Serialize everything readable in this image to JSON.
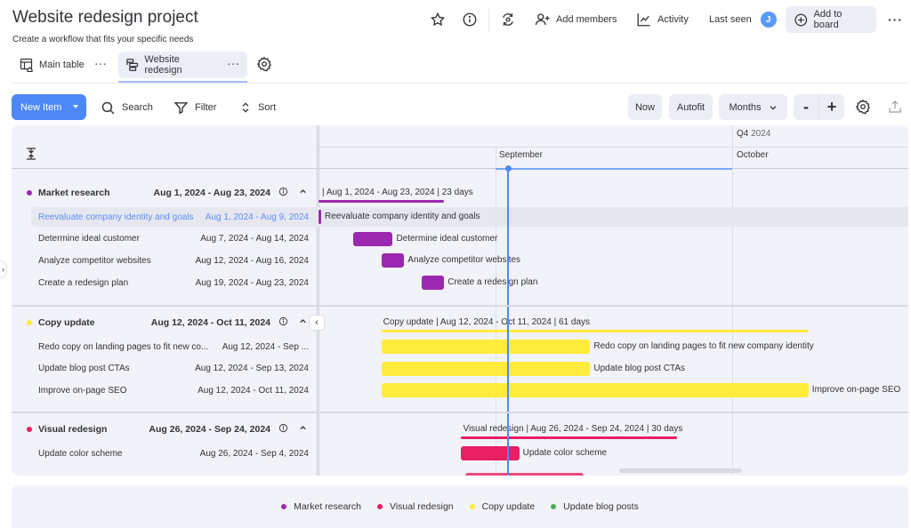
{
  "header": {
    "title": "Website redesign project",
    "subtitle": "Create a workflow that fits your specific needs",
    "views": [
      {
        "label": "Main table",
        "icon": "table-home-icon",
        "active": false
      },
      {
        "label": "Website redesign",
        "icon": "gantt-icon",
        "active": true
      }
    ],
    "more_glyph": "···",
    "actions": {
      "add_members": "Add members",
      "activity": "Activity",
      "last_seen": "Last seen",
      "avatar_initial": "J",
      "add_to_board": "Add to board"
    }
  },
  "toolbar": {
    "new_item": "New Item",
    "search": "Search",
    "filter": "Filter",
    "sort": "Sort",
    "now": "Now",
    "autofit": "Autofit",
    "scale": "Months",
    "zoom_out": "-",
    "zoom_in": "+"
  },
  "timeline": {
    "quarter_label": "Q4",
    "quarter_year": "2024",
    "months": [
      "September",
      "October"
    ],
    "today_marker": "Sep 1, 2024"
  },
  "groups": [
    {
      "name": "Market research",
      "dates": "Aug 1, 2024 - Aug 23, 2024",
      "color": "#9c27b0",
      "chart_label": "| Aug 1, 2024 - Aug 23, 2024 | 23 days",
      "items": [
        {
          "name": "Reevaluate company identity and goals",
          "dates": "Aug 1, 2024 - Aug 9, 2024",
          "selected": true
        },
        {
          "name": "Determine ideal customer",
          "dates": "Aug 7, 2024 - Aug 14, 2024"
        },
        {
          "name": "Analyze competitor websites",
          "dates": "Aug 12, 2024 - Aug 16, 2024"
        },
        {
          "name": "Create a redesign plan",
          "dates": "Aug 19, 2024 - Aug 23, 2024"
        }
      ]
    },
    {
      "name": "Copy update",
      "dates": "Aug 12, 2024 - Oct 11, 2024",
      "color": "#ffeb3b",
      "chart_label": "Copy update | Aug 12, 2024 - Oct 11, 2024 | 61 days",
      "items": [
        {
          "name": "Redo copy on landing pages to fit new co...",
          "full_name": "Redo copy on landing pages to fit new company identity",
          "dates": "Aug 12, 2024 - Sep ..."
        },
        {
          "name": "Update blog post CTAs",
          "dates": "Aug 12, 2024 - Sep 13, 2024"
        },
        {
          "name": "Improve on-page SEO",
          "full_name": "Improve on-page SEO",
          "dates": "Aug 12, 2024 - Oct 11, 2024"
        }
      ]
    },
    {
      "name": "Visual redesign",
      "dates": "Aug 26, 2024 - Sep 24, 2024",
      "color": "#e91e63",
      "chart_label": "Visual redesign | Aug 26, 2024 - Sep 24, 2024 | 30 days",
      "items": [
        {
          "name": "Update color scheme",
          "dates": "Aug 26, 2024 - Sep 4, 2024"
        }
      ]
    }
  ],
  "legend": [
    {
      "label": "Market research",
      "color": "#9c27b0"
    },
    {
      "label": "Visual redesign",
      "color": "#e91e63"
    },
    {
      "label": "Copy update",
      "color": "#ffeb3b"
    },
    {
      "label": "Update blog posts",
      "color": "#4caf50"
    }
  ],
  "colors": {
    "accent": "#4c89f7",
    "selected_text": "#5b8ef7"
  }
}
